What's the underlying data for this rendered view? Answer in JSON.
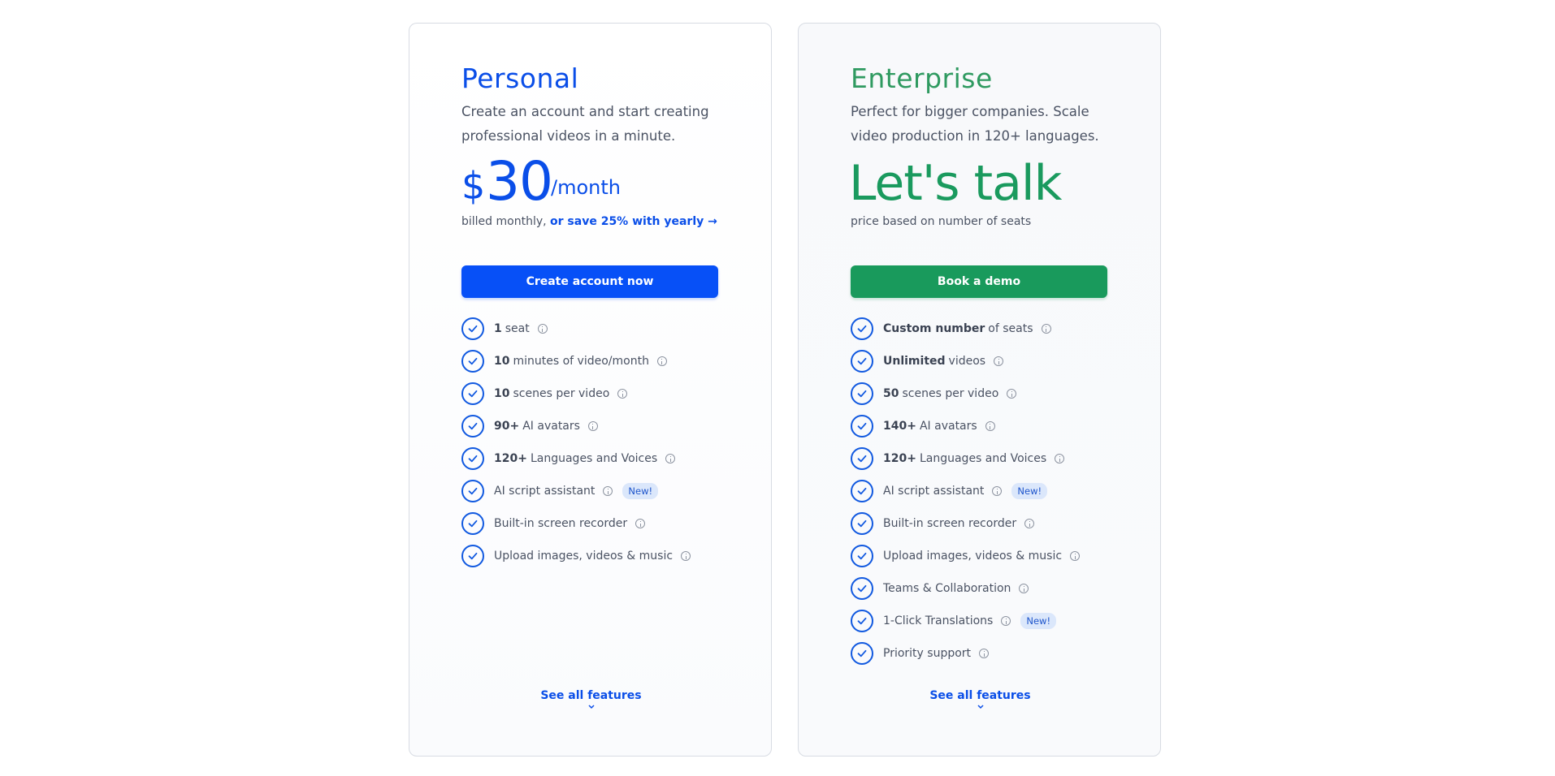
{
  "personal": {
    "title": "Personal",
    "description": "Create an account and start creating professional videos in a minute.",
    "currency": "$",
    "amount": "30",
    "period": "/month",
    "billing_prefix": "billed monthly,",
    "billing_link": "or save 25% with yearly →",
    "cta": "Create account now",
    "features": [
      {
        "bold": "1",
        "text": "seat",
        "badge": ""
      },
      {
        "bold": "10",
        "text": "minutes of video/month",
        "badge": ""
      },
      {
        "bold": "10",
        "text": "scenes per video",
        "badge": ""
      },
      {
        "bold": "90+",
        "text": "AI avatars",
        "badge": ""
      },
      {
        "bold": "120+",
        "text": "Languages and Voices",
        "badge": ""
      },
      {
        "bold": "",
        "text": "AI script assistant",
        "badge": "New!"
      },
      {
        "bold": "",
        "text": "Built-in screen recorder",
        "badge": ""
      },
      {
        "bold": "",
        "text": "Upload images, videos & music",
        "badge": ""
      }
    ],
    "see_all": "See all features"
  },
  "enterprise": {
    "title": "Enterprise",
    "description": "Perfect for bigger companies. Scale video production in 120+ languages.",
    "price_text": "Let's talk",
    "billing": "price based on number of seats",
    "cta": "Book a demo",
    "features": [
      {
        "bold": "Custom number",
        "text": "of seats",
        "badge": ""
      },
      {
        "bold": "Unlimited",
        "text": "videos",
        "badge": ""
      },
      {
        "bold": "50",
        "text": "scenes per video",
        "badge": ""
      },
      {
        "bold": "140+",
        "text": "AI avatars",
        "badge": ""
      },
      {
        "bold": "120+",
        "text": "Languages and Voices",
        "badge": ""
      },
      {
        "bold": "",
        "text": "AI script assistant",
        "badge": "New!"
      },
      {
        "bold": "",
        "text": "Built-in screen recorder",
        "badge": ""
      },
      {
        "bold": "",
        "text": "Upload images, videos & music",
        "badge": ""
      },
      {
        "bold": "",
        "text": "Teams & Collaboration",
        "badge": ""
      },
      {
        "bold": "",
        "text": "1-Click Translations",
        "badge": "New!"
      },
      {
        "bold": "",
        "text": "Priority support",
        "badge": ""
      }
    ],
    "see_all": "See all features"
  },
  "colors": {
    "personal_accent": "#0a4ee8",
    "enterprise_accent": "#199a5c",
    "check": "#1159e0",
    "badge_bg": "#dbe7fb"
  }
}
